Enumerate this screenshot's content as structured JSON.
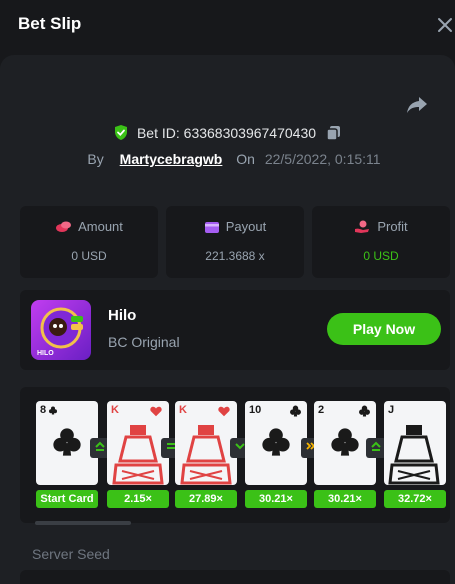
{
  "header": {
    "title": "Bet Slip"
  },
  "bet": {
    "id_label": "Bet ID:",
    "id": "6336830396747043\u00130",
    "by_label": "By",
    "user": "Martycebragwb",
    "on_label": "On",
    "date": "22/5/2022, 0:15:11"
  },
  "stats": [
    {
      "label": "Amount",
      "value": "0 USD",
      "icon": "coins-icon"
    },
    {
      "label": "Payout",
      "value": "221.3688 x",
      "icon": "wallet-icon"
    },
    {
      "label": "Profit",
      "value": "0 USD",
      "icon": "hand-coin-icon",
      "color": "#3bc117"
    }
  ],
  "game": {
    "name": "Hilo",
    "provider": "BC Original",
    "play_label": "Play Now",
    "thumb_text": "HILO"
  },
  "cards": [
    {
      "rank": "8",
      "suit": "clubs",
      "color": "black",
      "multiplier": "Start Card"
    },
    {
      "rank": "K",
      "suit": "hearts",
      "color": "red",
      "multiplier": "2.15×",
      "op": "higher"
    },
    {
      "rank": "K",
      "suit": "hearts",
      "color": "red",
      "multiplier": "27.89×",
      "op": "same"
    },
    {
      "rank": "10",
      "suit": "clubs",
      "color": "black",
      "multiplier": "30.21×",
      "op": "lower"
    },
    {
      "rank": "2",
      "suit": "clubs",
      "color": "black",
      "multiplier": "30.21×",
      "op": "skip"
    },
    {
      "rank": "J",
      "suit": "clubs",
      "color": "black",
      "multiplier": "32.72×",
      "op": "higher"
    }
  ],
  "seed": {
    "label": "Server Seed"
  },
  "colors": {
    "accent": "#3bc117",
    "bg": "#17181b",
    "panel": "#1e2024"
  }
}
